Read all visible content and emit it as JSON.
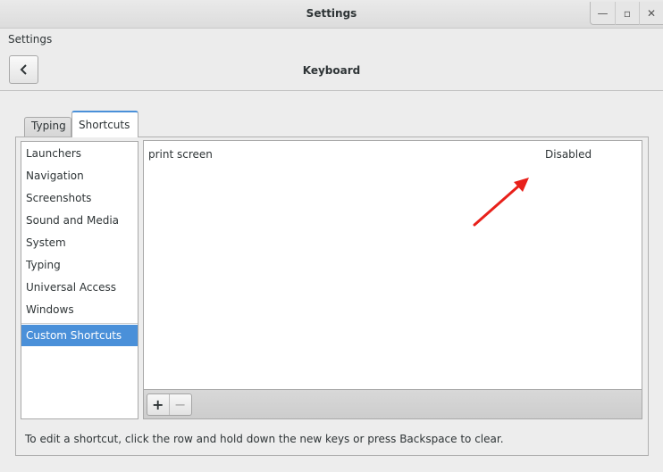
{
  "window": {
    "title": "Settings",
    "controls": [
      {
        "name": "minimize",
        "glyph": "—"
      },
      {
        "name": "maximize",
        "glyph": "▫"
      },
      {
        "name": "close",
        "glyph": "✕"
      }
    ]
  },
  "header": {
    "breadcrumb": "Settings",
    "panel_title": "Keyboard",
    "back_icon": "chevron-left-icon"
  },
  "tabs": [
    {
      "label": "Typing",
      "active": false
    },
    {
      "label": "Shortcuts",
      "active": true
    }
  ],
  "sections": {
    "items": [
      {
        "label": "Launchers"
      },
      {
        "label": "Navigation"
      },
      {
        "label": "Screenshots"
      },
      {
        "label": "Sound and Media"
      },
      {
        "label": "System"
      },
      {
        "label": "Typing"
      },
      {
        "label": "Universal Access"
      },
      {
        "label": "Windows"
      }
    ],
    "custom": {
      "label": "Custom Shortcuts",
      "selected": true
    }
  },
  "shortcuts": {
    "rows": [
      {
        "name": "print screen",
        "accelerator": "Disabled"
      }
    ]
  },
  "toolbar": {
    "add_label": "+",
    "remove_label": "−"
  },
  "hint": "To edit a shortcut, click the row and hold down the new keys or press Backspace to clear.",
  "annotation": {
    "color": "#e8201a"
  },
  "colors": {
    "accent": "#4a90d9"
  }
}
